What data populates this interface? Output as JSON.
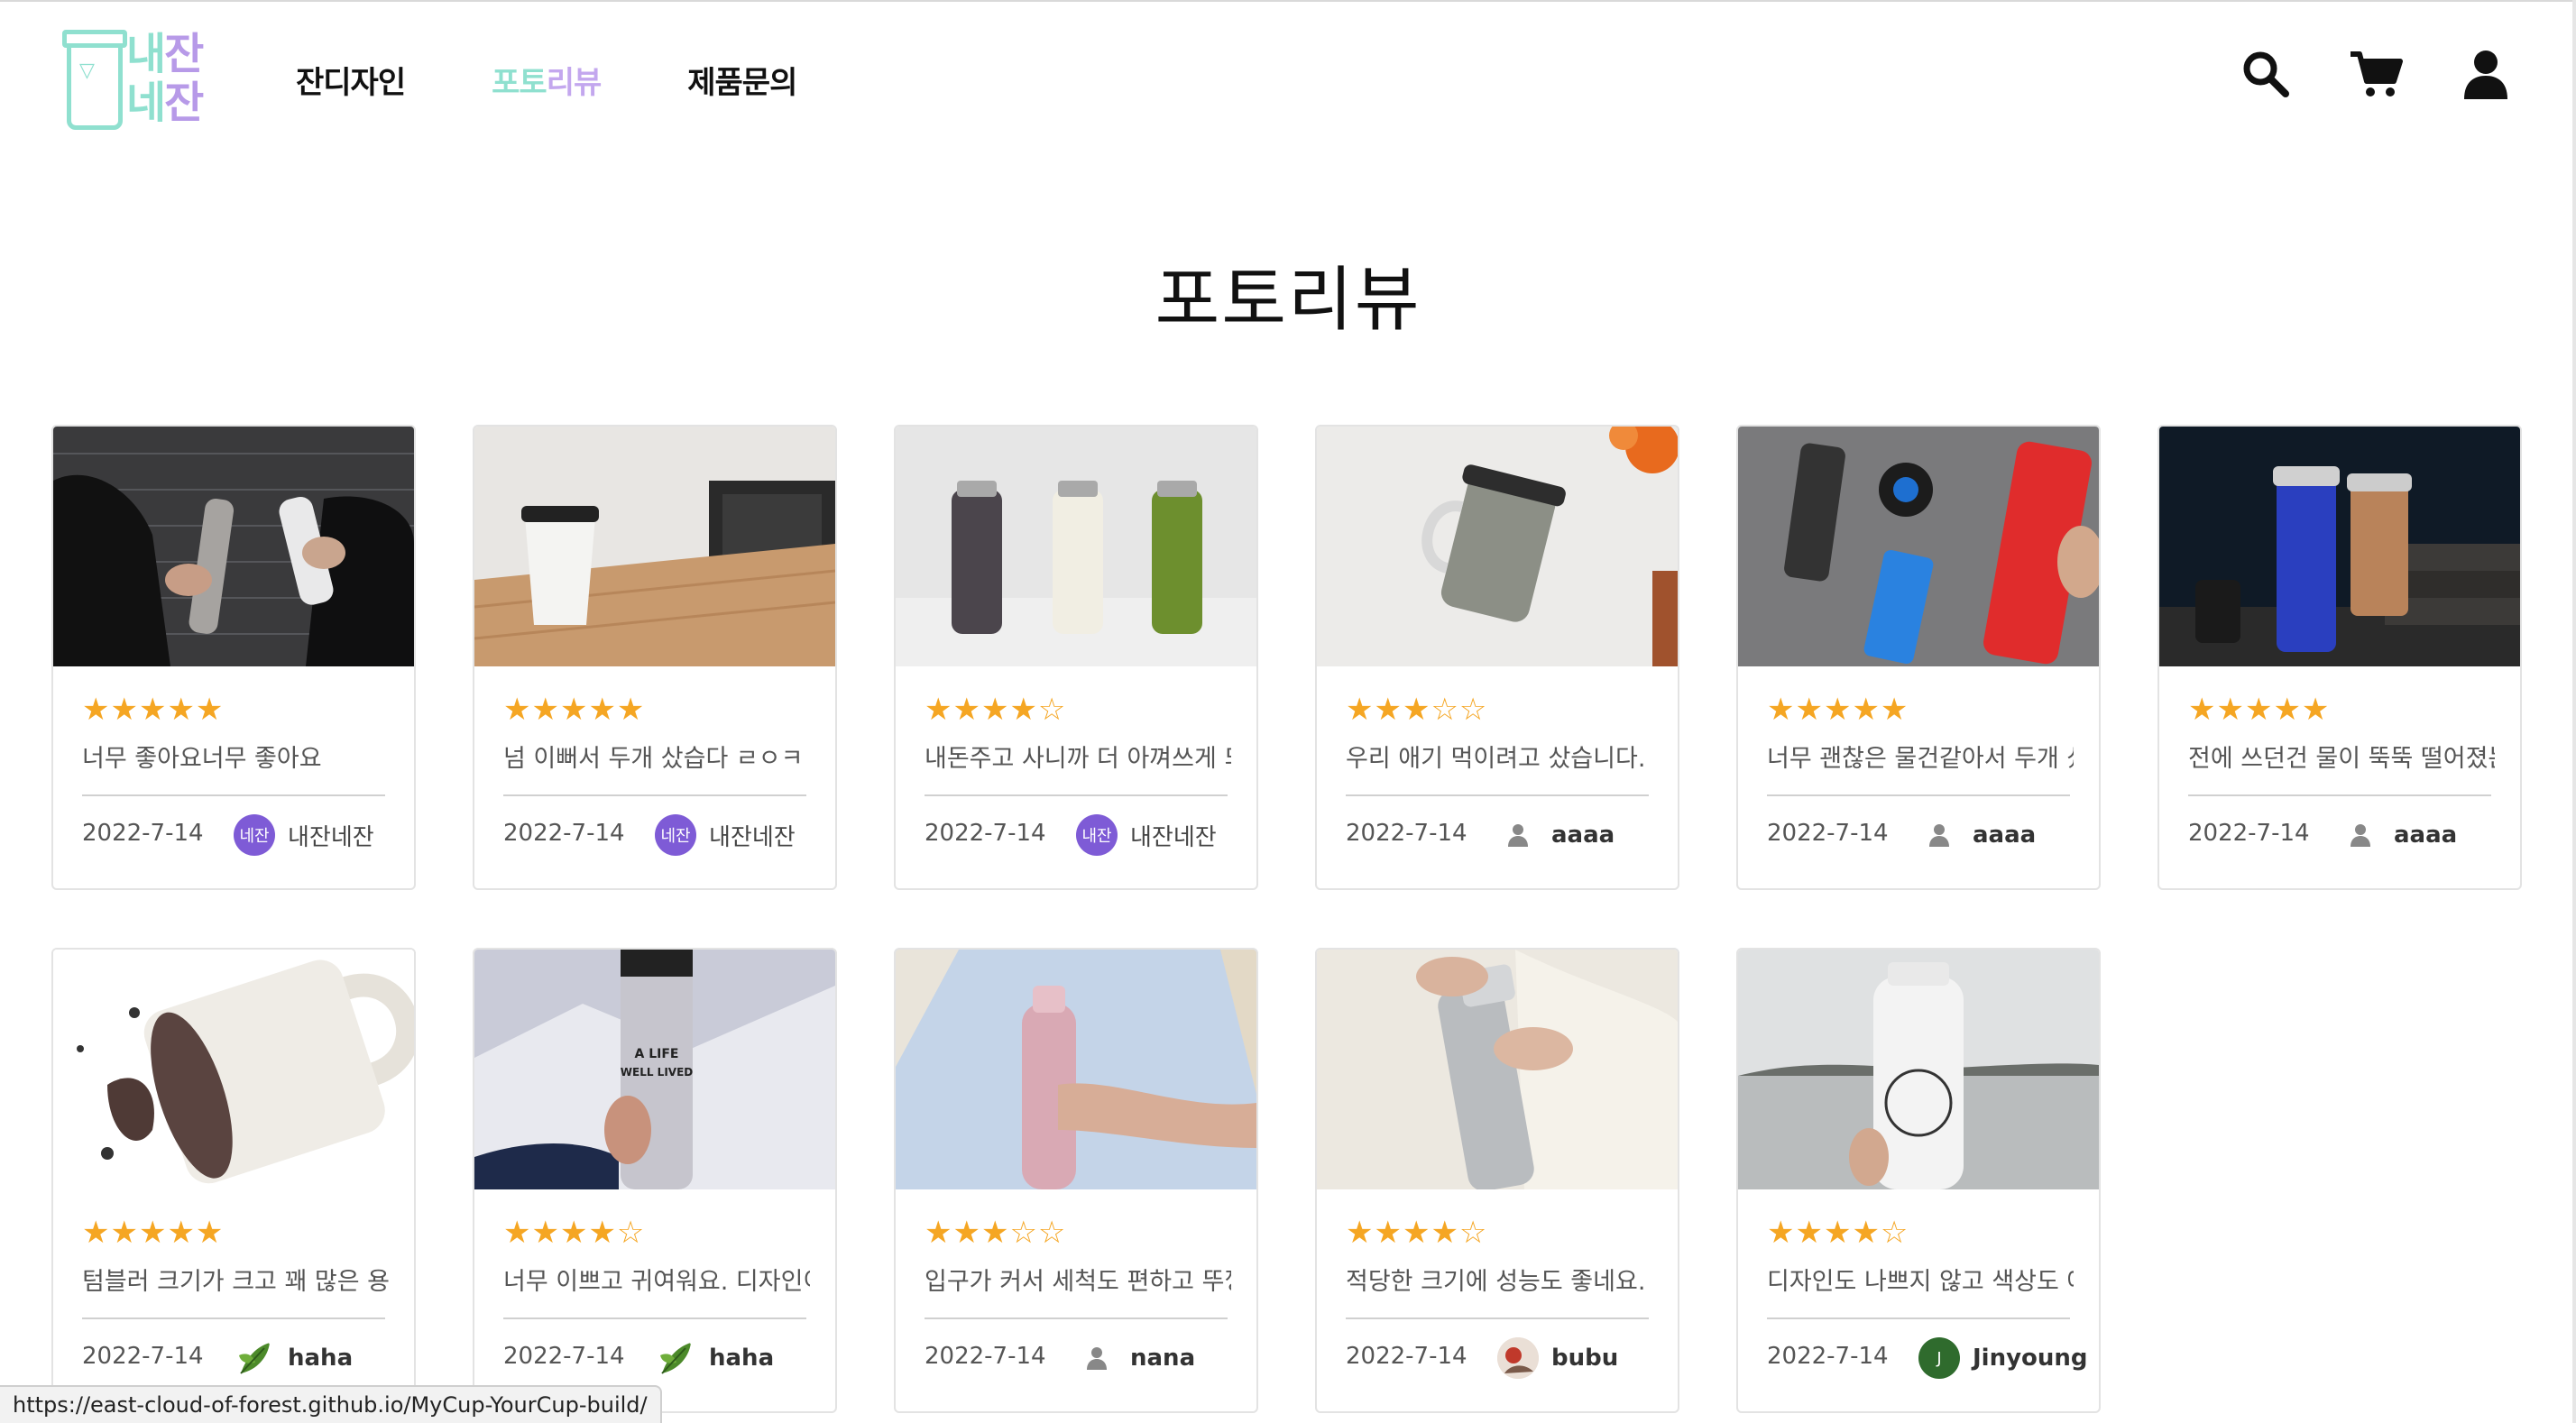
{
  "header": {
    "logo": {
      "line1": "내잔",
      "line2": "네잔",
      "line1_a": "내",
      "line1_b": "잔",
      "line2_a": "네",
      "line2_b": "잔"
    },
    "nav": [
      {
        "label": "잔디자인"
      },
      {
        "label_main": "포토",
        "label_sub": "리뷰",
        "label": "포토리뷰",
        "active": true
      },
      {
        "label": "제품문의"
      }
    ],
    "icons": [
      "search-icon",
      "cart-icon",
      "user-icon"
    ]
  },
  "title": "포토리뷰",
  "colors": {
    "mint": "#8fe0cf",
    "lavender": "#b79ae8",
    "star": "#f5a623",
    "avatar_purple": "#7e5bd6",
    "avatar_green": "#2f6b2d"
  },
  "reviews": [
    {
      "rating": 5,
      "text": "너무 좋아요너무 좋아요",
      "date": "2022-7-14",
      "author": "내잔네잔",
      "avatar": "brand",
      "avatar_text": "네잔"
    },
    {
      "rating": 5,
      "text": "넘 이뻐서 두개 샀습다 ㄹㅇㅋ",
      "date": "2022-7-14",
      "author": "내잔네잔",
      "avatar": "brand",
      "avatar_text": "네잔"
    },
    {
      "rating": 4,
      "text": "내돈주고 사니까 더 아껴쓰게 되네요",
      "date": "2022-7-14",
      "author": "내잔네잔",
      "avatar": "brand",
      "avatar_text": "내잔"
    },
    {
      "rating": 3,
      "text": "우리 애기 먹이려고 샀습니다.",
      "date": "2022-7-14",
      "author": "aaaa",
      "avatar": "default"
    },
    {
      "rating": 5,
      "text": "너무 괜찮은 물건같아서 두개 샀어요",
      "date": "2022-7-14",
      "author": "aaaa",
      "avatar": "default"
    },
    {
      "rating": 5,
      "text": "전에 쓰던건 물이 뚝뚝 떨어졌는데",
      "date": "2022-7-14",
      "author": "aaaa",
      "avatar": "default"
    },
    {
      "rating": 5,
      "text": "텀블러 크기가 크고 꽤 많은 용량이에요",
      "date": "2022-7-14",
      "author": "haha",
      "avatar": "leaf"
    },
    {
      "rating": 4,
      "text": "너무 이쁘고 귀여워요. 디자인이 최고",
      "date": "2022-7-14",
      "author": "haha",
      "avatar": "leaf"
    },
    {
      "rating": 3,
      "text": "입구가 커서 세척도 편하고 뚜껑도",
      "date": "2022-7-14",
      "author": "nana",
      "avatar": "default"
    },
    {
      "rating": 4,
      "text": "적당한 크기에 성능도 좋네요.",
      "date": "2022-7-14",
      "author": "bubu",
      "avatar": "photo"
    },
    {
      "rating": 4,
      "text": "디자인도 나쁘지 않고 색상도 예뻐요",
      "date": "2022-7-14",
      "author": "Jinyoung",
      "avatar": "letter",
      "avatar_text": "J"
    }
  ],
  "status_url": "https://east-cloud-of-forest.github.io/MyCup-YourCup-build/"
}
